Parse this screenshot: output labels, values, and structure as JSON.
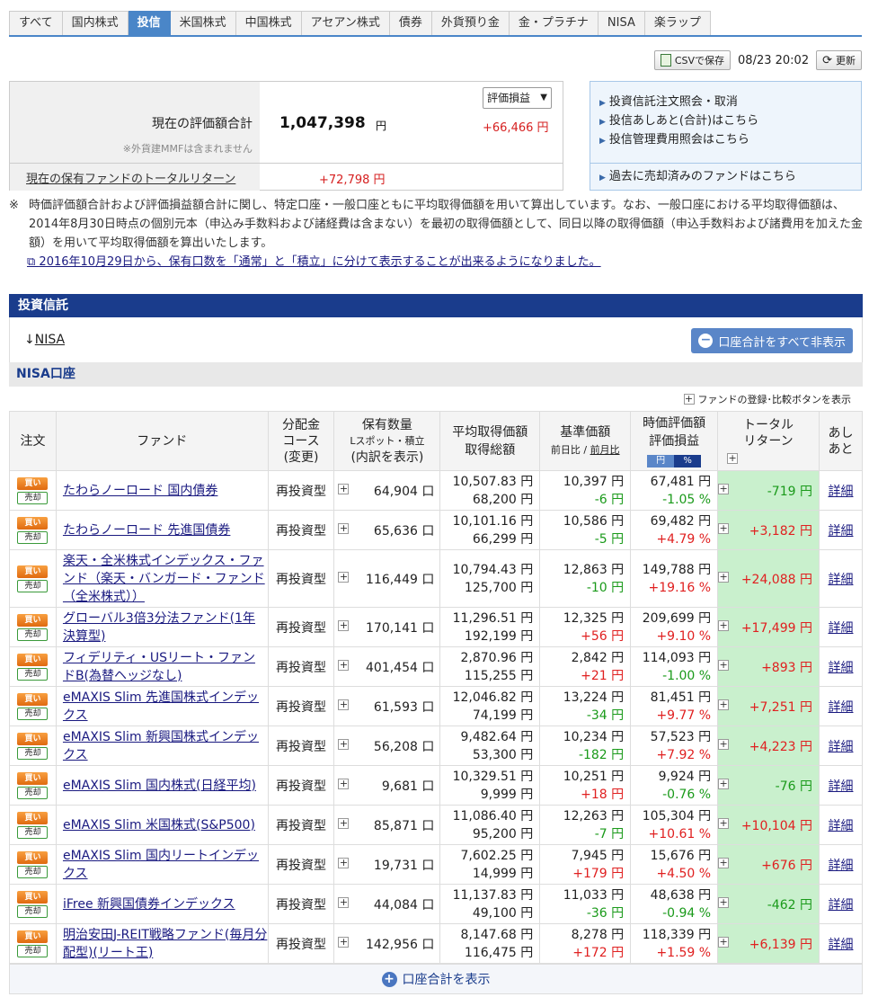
{
  "tabs": [
    {
      "label": "すべて"
    },
    {
      "label": "国内株式"
    },
    {
      "label": "投信",
      "active": true
    },
    {
      "label": "米国株式"
    },
    {
      "label": "中国株式"
    },
    {
      "label": "アセアン株式"
    },
    {
      "label": "債券"
    },
    {
      "label": "外貨預り金"
    },
    {
      "label": "金・プラチナ"
    },
    {
      "label": "NISA"
    },
    {
      "label": "楽ラップ"
    }
  ],
  "toolbar": {
    "csv_label": "CSVで保存",
    "timestamp": "08/23 20:02",
    "refresh_label": "更新"
  },
  "summary": {
    "total_label": "現在の評価額合計",
    "note": "※外貨建MMFは含まれません",
    "total_value": "1,047,398",
    "unit": "円",
    "select_label": "評価損益",
    "gain": "+66,466 円",
    "return_label": "現在の保有ファンドのトータルリターン",
    "return_value": "+72,798 円"
  },
  "side_links": {
    "items": [
      "投資信託注文照会・取消",
      "投信あしあと(合計)はこちら",
      "投信管理費用照会はこちら"
    ],
    "bottom": "過去に売却済みのファンドはこちら"
  },
  "notes": {
    "mark": "※",
    "text": "時価評価額合計および評価損益額合計に関し、特定口座・一般口座ともに平均取得価額を用いて算出しています。なお、一般口座における平均取得価額は、2014年8月30日時点の個別元本（申込み手数料および諸経費は含まない）を最初の取得価額として、同日以降の取得価額（申込手数料および諸費用を加えた金額）を用いて平均取得価額を算出いたします。",
    "link": "2016年10月29日から、保有口数を「通常」と「積立」に分けて表示することが出来るようになりました。"
  },
  "section": {
    "title": "投資信託",
    "nisa_arrow": "↓",
    "nisa_link": "NISA",
    "hide_all_label": "口座合計をすべて非表示",
    "account_title": "NISA口座",
    "fund_register_label": "ファンドの登録･比較ボタンを表示"
  },
  "table": {
    "headers": {
      "order": "注文",
      "fund": "ファンド",
      "div_1": "分配金",
      "div_2": "コース",
      "div_3": "(変更)",
      "qty_1": "保有数量",
      "qty_2": "Lスポット・積立",
      "qty_3": "(内訳を表示)",
      "avg_1": "平均取得価額",
      "avg_2": "取得総額",
      "base_1": "基準価額",
      "base_2": "前日比",
      "base_sep": " / ",
      "base_3": "前月比",
      "eval_1": "時価評価額",
      "eval_2": "評価損益",
      "ccy_yen": "円",
      "ccy_pct": "%",
      "ret_1": "トータル",
      "ret_2": "リターン",
      "hist_1": "あし",
      "hist_2": "あと"
    },
    "buy_label": "買い",
    "sell_label": "売却",
    "detail_label": "詳細",
    "rows": [
      {
        "fund": "たわらノーロード 国内債券",
        "course": "再投資型",
        "qty": "64,904 口",
        "avg": "10,507.83 円",
        "cost": "68,200 円",
        "base": "10,397 円",
        "base_chg": "-6 円",
        "base_sign": "neg",
        "eval": "67,481 円",
        "eval_pct": "-1.05 %",
        "eval_sign": "neg",
        "ret": "-719 円",
        "ret_sign": "neg"
      },
      {
        "fund": "たわらノーロード 先進国債券",
        "course": "再投資型",
        "qty": "65,636 口",
        "avg": "10,101.16 円",
        "cost": "66,299 円",
        "base": "10,586 円",
        "base_chg": "-5 円",
        "base_sign": "neg",
        "eval": "69,482 円",
        "eval_pct": "+4.79 %",
        "eval_sign": "pos",
        "ret": "+3,182 円",
        "ret_sign": "pos"
      },
      {
        "fund": "楽天・全米株式インデックス・ファンド（楽天・バンガード・ファンド（全米株式））",
        "course": "再投資型",
        "qty": "116,449 口",
        "avg": "10,794.43 円",
        "cost": "125,700 円",
        "base": "12,863 円",
        "base_chg": "-10 円",
        "base_sign": "neg",
        "eval": "149,788 円",
        "eval_pct": "+19.16 %",
        "eval_sign": "pos",
        "ret": "+24,088 円",
        "ret_sign": "pos",
        "tall": true
      },
      {
        "fund": "グローバル3倍3分法ファンド(1年決算型)",
        "course": "再投資型",
        "qty": "170,141 口",
        "avg": "11,296.51 円",
        "cost": "192,199 円",
        "base": "12,325 円",
        "base_chg": "+56 円",
        "base_sign": "pos",
        "eval": "209,699 円",
        "eval_pct": "+9.10 %",
        "eval_sign": "pos",
        "ret": "+17,499 円",
        "ret_sign": "pos"
      },
      {
        "fund": "フィデリティ・USリート・ファンドB(為替ヘッジなし)",
        "course": "再投資型",
        "qty": "401,454 口",
        "avg": "2,870.96 円",
        "cost": "115,255 円",
        "base": "2,842 円",
        "base_chg": "+21 円",
        "base_sign": "pos",
        "eval": "114,093 円",
        "eval_pct": "-1.00 %",
        "eval_sign": "neg",
        "ret": "+893 円",
        "ret_sign": "pos"
      },
      {
        "fund": "eMAXIS Slim 先進国株式インデックス",
        "course": "再投資型",
        "qty": "61,593 口",
        "avg": "12,046.82 円",
        "cost": "74,199 円",
        "base": "13,224 円",
        "base_chg": "-34 円",
        "base_sign": "neg",
        "eval": "81,451 円",
        "eval_pct": "+9.77 %",
        "eval_sign": "pos",
        "ret": "+7,251 円",
        "ret_sign": "pos"
      },
      {
        "fund": "eMAXIS Slim 新興国株式インデックス",
        "course": "再投資型",
        "qty": "56,208 口",
        "avg": "9,482.64 円",
        "cost": "53,300 円",
        "base": "10,234 円",
        "base_chg": "-182 円",
        "base_sign": "neg",
        "eval": "57,523 円",
        "eval_pct": "+7.92 %",
        "eval_sign": "pos",
        "ret": "+4,223 円",
        "ret_sign": "pos"
      },
      {
        "fund": "eMAXIS Slim 国内株式(日経平均)",
        "course": "再投資型",
        "qty": "9,681 口",
        "avg": "10,329.51 円",
        "cost": "9,999 円",
        "base": "10,251 円",
        "base_chg": "+18 円",
        "base_sign": "pos",
        "eval": "9,924 円",
        "eval_pct": "-0.76 %",
        "eval_sign": "neg",
        "ret": "-76 円",
        "ret_sign": "neg"
      },
      {
        "fund": "eMAXIS Slim 米国株式(S&P500)",
        "course": "再投資型",
        "qty": "85,871 口",
        "avg": "11,086.40 円",
        "cost": "95,200 円",
        "base": "12,263 円",
        "base_chg": "-7 円",
        "base_sign": "neg",
        "eval": "105,304 円",
        "eval_pct": "+10.61 %",
        "eval_sign": "pos",
        "ret": "+10,104 円",
        "ret_sign": "pos"
      },
      {
        "fund": "eMAXIS Slim 国内リートインデックス",
        "course": "再投資型",
        "qty": "19,731 口",
        "avg": "7,602.25 円",
        "cost": "14,999 円",
        "base": "7,945 円",
        "base_chg": "+179 円",
        "base_sign": "pos",
        "eval": "15,676 円",
        "eval_pct": "+4.50 %",
        "eval_sign": "pos",
        "ret": "+676 円",
        "ret_sign": "pos"
      },
      {
        "fund": "iFree 新興国債券インデックス",
        "course": "再投資型",
        "qty": "44,084 口",
        "avg": "11,137.83 円",
        "cost": "49,100 円",
        "base": "11,033 円",
        "base_chg": "-36 円",
        "base_sign": "neg",
        "eval": "48,638 円",
        "eval_pct": "-0.94 %",
        "eval_sign": "neg",
        "ret": "-462 円",
        "ret_sign": "neg"
      },
      {
        "fund": "明治安田J-REIT戦略ファンド(毎月分配型)(リート王)",
        "course": "再投資型",
        "qty": "142,956 口",
        "avg": "8,147.68 円",
        "cost": "116,475 円",
        "base": "8,278 円",
        "base_chg": "+172 円",
        "base_sign": "pos",
        "eval": "118,339 円",
        "eval_pct": "+1.59 %",
        "eval_sign": "pos",
        "ret": "+6,139 円",
        "ret_sign": "pos"
      }
    ]
  },
  "footer": {
    "show_total_label": "口座合計を表示"
  }
}
